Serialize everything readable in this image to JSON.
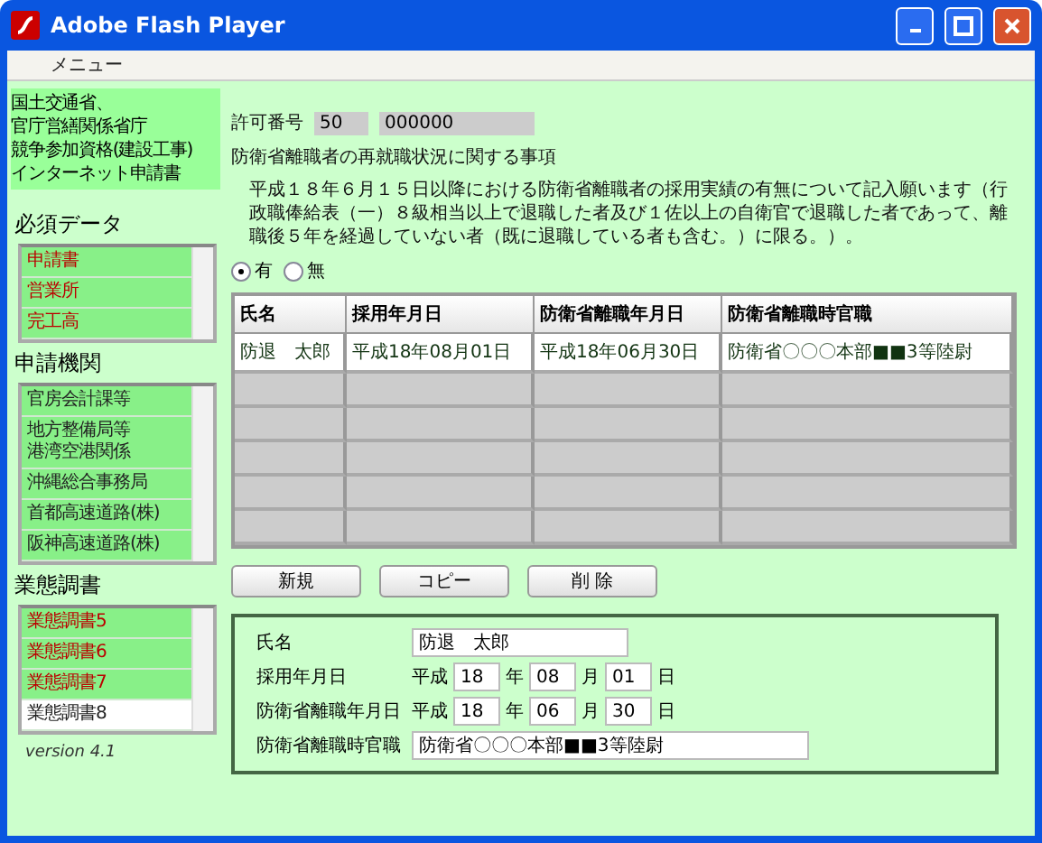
{
  "window": {
    "title": "Adobe Flash Player"
  },
  "menu": [
    "メニュー"
  ],
  "sidebar": {
    "heading_lines": [
      "国土交通省、",
      "官庁営繕関係省庁",
      "競争参加資格(建設工事)",
      "インターネット申請書"
    ],
    "groups": [
      {
        "label": "必須データ",
        "items": [
          {
            "label": "申請書",
            "incomplete": true,
            "selected": false
          },
          {
            "label": "営業所",
            "incomplete": true,
            "selected": false
          },
          {
            "label": "完工高",
            "incomplete": true,
            "selected": false
          }
        ]
      },
      {
        "label": "申請機関",
        "items": [
          {
            "label": "官房会計課等",
            "incomplete": false,
            "selected": false
          },
          {
            "label": [
              "地方整備局等",
              "港湾空港関係"
            ],
            "incomplete": false,
            "selected": false
          },
          {
            "label": "沖縄総合事務局",
            "incomplete": false,
            "selected": false
          },
          {
            "label": "首都高速道路(株)",
            "incomplete": false,
            "selected": false
          },
          {
            "label": "阪神高速道路(株)",
            "incomplete": false,
            "selected": false
          }
        ]
      },
      {
        "label": "業態調書",
        "items": [
          {
            "label": "業態調書5",
            "incomplete": true,
            "selected": false
          },
          {
            "label": "業態調書6",
            "incomplete": true,
            "selected": false
          },
          {
            "label": "業態調書7",
            "incomplete": true,
            "selected": false
          },
          {
            "label": "業態調書8",
            "incomplete": false,
            "selected": true
          }
        ]
      }
    ],
    "version": "version 4.1"
  },
  "permit": {
    "label": "許可番号",
    "values": [
      "50",
      "000000"
    ]
  },
  "section_title": "防衛省離職者の再就職状況に関する事項",
  "description": "平成１８年６月１５日以降における防衛省離職者の採用実績の有無について記入願います（行政職俸給表（一）８級相当以上で退職した者及び１佐以上の自衛官で退職した者であって、離職後５年を経過していない者（既に退職している者も含む。）に限る。）。",
  "radio": [
    {
      "label": "有",
      "selected": true
    },
    {
      "label": "無",
      "selected": false
    }
  ],
  "table": {
    "columns": [
      "氏名",
      "採用年月日",
      "防衛省離職年月日",
      "防衛省離職時官職"
    ],
    "rows": [
      [
        "防退　太郎",
        "平成18年08月01日",
        "平成18年06月30日",
        "防衛省〇〇〇本部■■3等陸尉"
      ]
    ]
  },
  "buttons": [
    "新規",
    "コピー",
    "削 除"
  ],
  "form": [
    {
      "kind": "text",
      "label": "氏名",
      "value": "防退　太郎"
    },
    {
      "kind": "date",
      "label": "採用年月日",
      "era": "平成",
      "parts": [
        {
          "value": "18",
          "unit": "年"
        },
        {
          "value": "08",
          "unit": "月"
        },
        {
          "value": "01",
          "unit": "日"
        }
      ]
    },
    {
      "kind": "date",
      "label": "防衛省離職年月日",
      "era": "平成",
      "parts": [
        {
          "value": "18",
          "unit": "年"
        },
        {
          "value": "06",
          "unit": "月"
        },
        {
          "value": "30",
          "unit": "日"
        }
      ]
    },
    {
      "kind": "wide",
      "label": "防衛省離職時官職",
      "value": "防衛省〇〇〇本部■■3等陸尉"
    }
  ]
}
